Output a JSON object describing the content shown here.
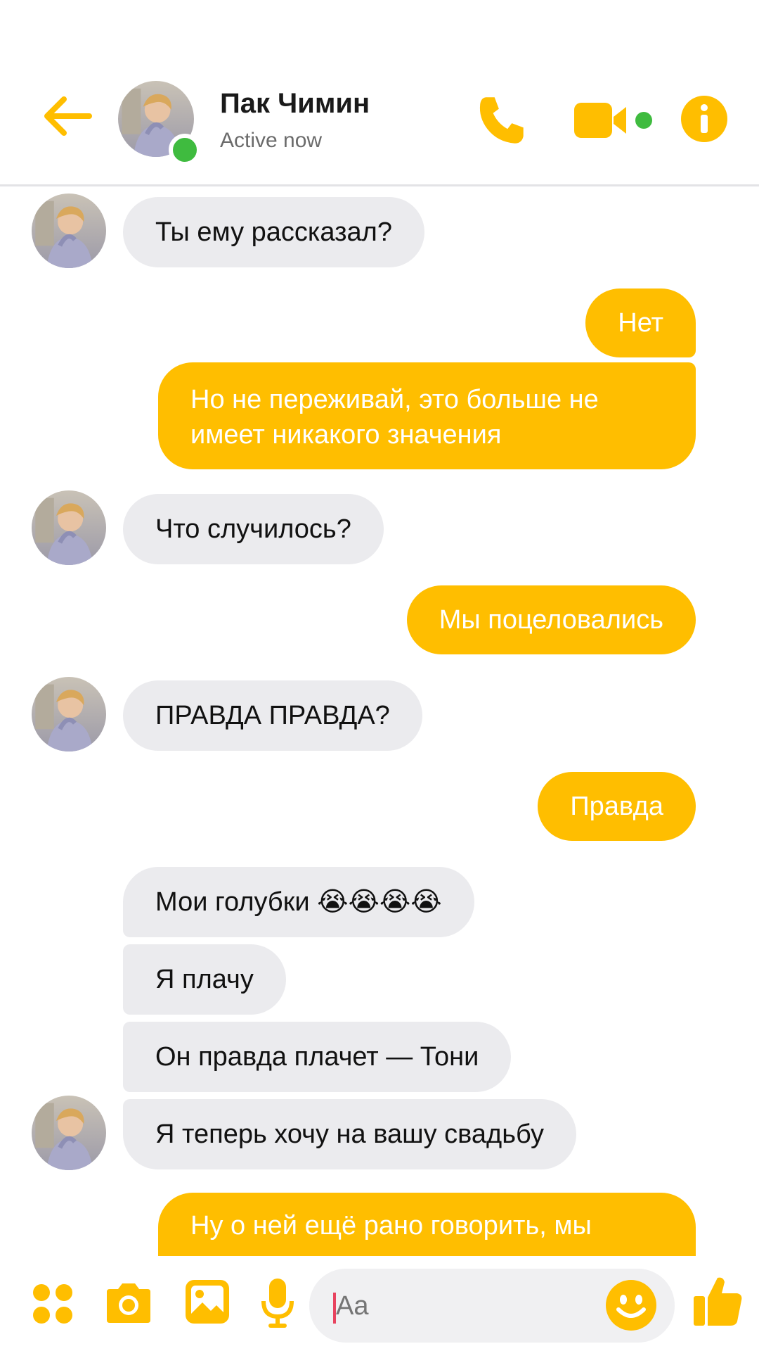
{
  "header": {
    "contact_name": "Пак Чимин",
    "status": "Active now"
  },
  "colors": {
    "accent": "#ffbe00",
    "incoming_bubble": "#ebebee",
    "presence": "#3fbb3f"
  },
  "icons": {
    "back": "arrow-left-icon",
    "call": "phone-icon",
    "video": "video-camera-icon",
    "info": "info-icon",
    "apps": "apps-grid-icon",
    "camera": "camera-icon",
    "gallery": "image-icon",
    "mic": "microphone-icon",
    "emoji": "smiley-icon",
    "like": "thumbs-up-icon"
  },
  "messages": [
    {
      "direction": "in",
      "text": "Ты ему рассказал?"
    },
    {
      "direction": "out",
      "text": "Нет"
    },
    {
      "direction": "out",
      "text": "Но не переживай, это больше не имеет никакого значения"
    },
    {
      "direction": "in",
      "text": "Что случилось?"
    },
    {
      "direction": "out",
      "text": "Мы поцеловались"
    },
    {
      "direction": "in",
      "text": "ПРАВДА ПРАВДА?"
    },
    {
      "direction": "out",
      "text": "Правда"
    },
    {
      "direction": "in",
      "text": "Мои голубки 😭😭😭😭"
    },
    {
      "direction": "in",
      "text": "Я плачу"
    },
    {
      "direction": "in",
      "text": "Он правда плачет — Тони"
    },
    {
      "direction": "in",
      "text": "Я теперь хочу на вашу свадьбу"
    },
    {
      "direction": "out",
      "text": "Ну о ней ещё рано говорить, мы"
    }
  ],
  "composer": {
    "placeholder": "Aa"
  }
}
